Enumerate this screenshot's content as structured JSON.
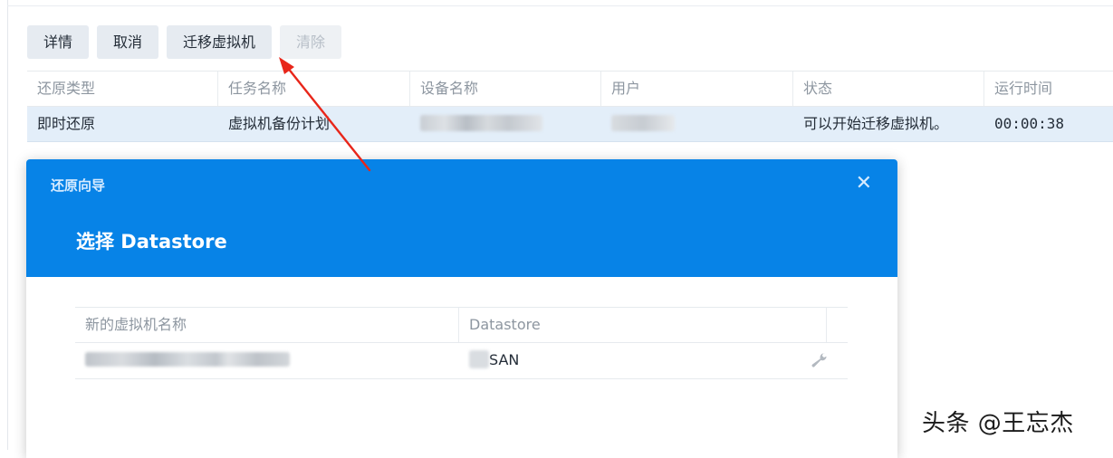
{
  "toolbar": {
    "details": "详情",
    "cancel": "取消",
    "migrate_vm": "迁移虚拟机",
    "clear": "清除"
  },
  "task_table": {
    "headers": [
      "还原类型",
      "任务名称",
      "设备名称",
      "用户",
      "状态",
      "运行时间"
    ],
    "rows": [
      {
        "restore_type": "即时还原",
        "task_name": "虚拟机备份计划",
        "status": "可以开始迁移虚拟机。",
        "run_time": "00:00:38"
      }
    ]
  },
  "dialog": {
    "title": "还原向导",
    "step_title": "选择 Datastore",
    "close_icon": "close-icon",
    "table": {
      "headers": [
        "新的虚拟机名称",
        "Datastore"
      ],
      "rows": [
        {
          "datastore": "SAN",
          "action_icon": "wrench-icon"
        }
      ]
    }
  },
  "watermark": "头条 @王忘杰",
  "colors": {
    "dialog_header": "#0783e7",
    "selected_row": "#e3eef9",
    "button_bg": "#e6ebf1",
    "annotation_arrow": "#e8261a"
  }
}
